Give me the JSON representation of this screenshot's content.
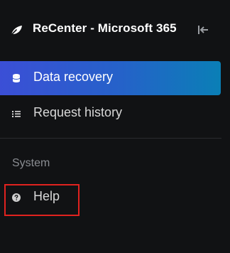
{
  "app": {
    "title": "ReCenter - Microsoft 365",
    "logo_icon": "leaf-icon",
    "collapse_icon": "collapse-sidebar-icon"
  },
  "nav": {
    "items": [
      {
        "label": "Data recovery",
        "icon": "database-icon",
        "active": true
      },
      {
        "label": "Request history",
        "icon": "list-icon",
        "active": false
      }
    ]
  },
  "system": {
    "section_label": "System",
    "items": [
      {
        "label": "Help",
        "icon": "help-circle-icon",
        "highlighted": true
      }
    ]
  },
  "colors": {
    "background": "#111214",
    "active_gradient_start": "#3b4fd6",
    "active_gradient_end": "#0a7fb6",
    "highlight_border": "#e0221f",
    "section_label": "#8a8d92"
  }
}
